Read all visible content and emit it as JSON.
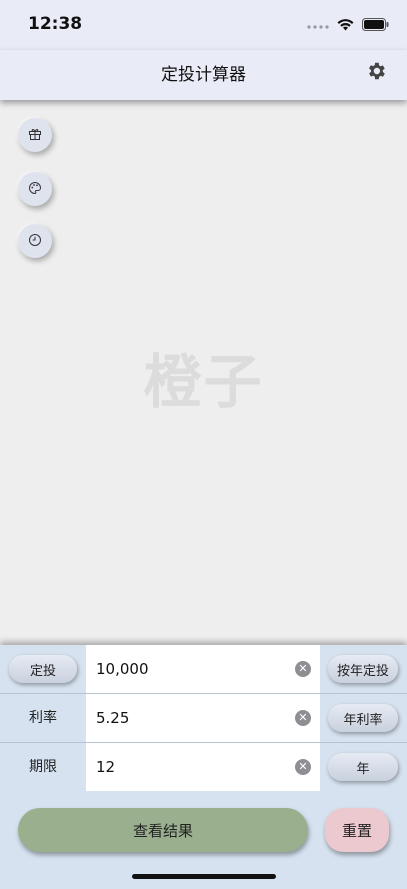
{
  "status": {
    "time": "12:38"
  },
  "nav": {
    "title": "定投计算器"
  },
  "side_buttons": [
    {
      "icon": "gift-icon"
    },
    {
      "icon": "palette-icon"
    },
    {
      "icon": "clock-icon"
    }
  ],
  "watermark": "橙子",
  "rows": [
    {
      "label": "定投",
      "value": "10,000",
      "unit": "按年定投"
    },
    {
      "label": "利率",
      "value": "5.25",
      "unit": "年利率"
    },
    {
      "label": "期限",
      "value": "12",
      "unit": "年"
    }
  ],
  "actions": {
    "result_label": "查看结果",
    "reset_label": "重置"
  },
  "colors": {
    "result": "#9aaf8e",
    "reset": "#ecc9cf",
    "panel": "#d6e2ef",
    "nav": "#e9ebf7"
  }
}
